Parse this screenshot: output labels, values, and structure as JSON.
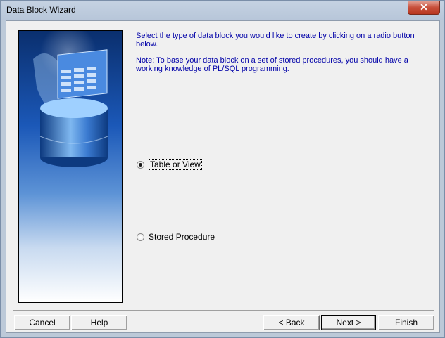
{
  "window": {
    "title": "Data Block Wizard",
    "close_label": "✕"
  },
  "intro": {
    "line1": "Select the type of data block you would like to create by clicking on a radio button below.",
    "note": "Note: To base your data block on a set of stored procedures, you should have a working knowledge of PL/SQL programming."
  },
  "options": [
    {
      "label": "Table or View",
      "selected": true
    },
    {
      "label": "Stored Procedure",
      "selected": false
    }
  ],
  "buttons": {
    "cancel": "Cancel",
    "help": "Help",
    "back": "< Back",
    "next": "Next >",
    "finish": "Finish"
  },
  "colors": {
    "text_blue": "#0000a8",
    "title_bar": "#bcc9d8",
    "dialog_bg": "#f0f0f0"
  }
}
